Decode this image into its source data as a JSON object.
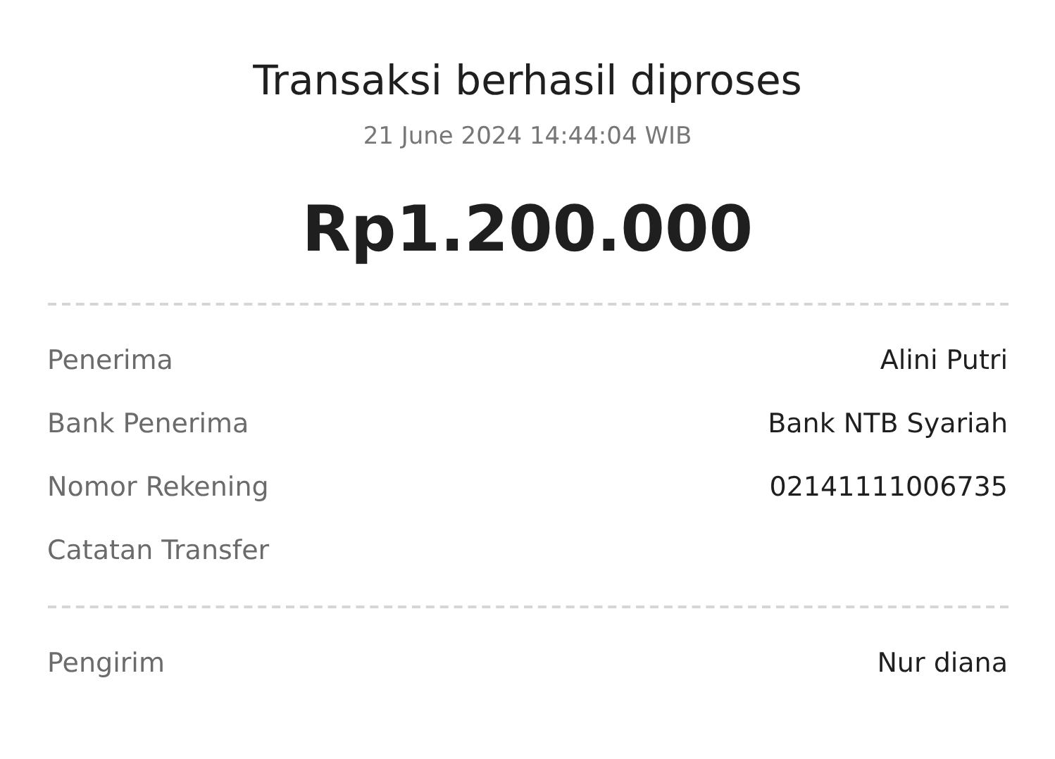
{
  "title": "Transaksi berhasil diproses",
  "datetime": "21 June 2024 14:44:04 WIB",
  "amount": "Rp1.200.000",
  "sections": [
    {
      "rows": [
        {
          "label": "Penerima",
          "value": "Alini Putri"
        },
        {
          "label": "Bank Penerima",
          "value": "Bank NTB Syariah"
        },
        {
          "label": "Nomor Rekening",
          "value": "02141111006735"
        },
        {
          "label": "Catatan Transfer"
        }
      ]
    },
    {
      "rows": [
        {
          "label": "Pengirim",
          "value": "Nur diana"
        }
      ]
    }
  ]
}
